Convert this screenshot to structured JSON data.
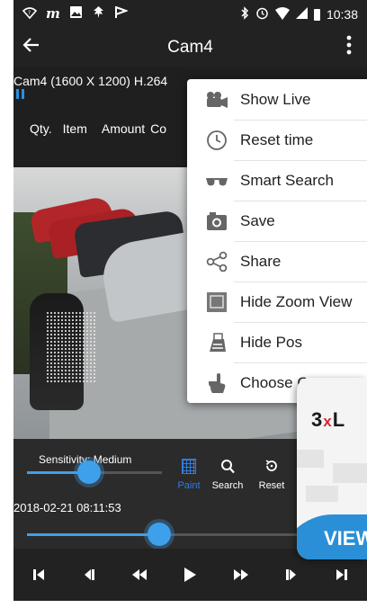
{
  "status_bar": {
    "left_icons": [
      "wifi-icon",
      "m-app-icon",
      "image-icon",
      "leaf-icon",
      "flag-icon"
    ],
    "right_icons": [
      "bluetooth-icon",
      "alarm-icon",
      "wifi-signal-icon",
      "cell-signal-icon",
      "battery-icon"
    ],
    "time": "10:38"
  },
  "app_bar": {
    "title": "Cam4",
    "back_icon": "arrow-left-icon",
    "overflow_icon": "more-vert-icon"
  },
  "camera": {
    "info": "Cam4 (1600 X 1200)  H.264",
    "state_icon": "pause-icon"
  },
  "pos_header": {
    "columns": [
      "Qty.",
      "Item",
      "Amount",
      "Co"
    ]
  },
  "menu": {
    "items": [
      {
        "label": "Show Live",
        "icon": "video-camera-icon"
      },
      {
        "label": "Reset time",
        "icon": "clock-icon"
      },
      {
        "label": "Smart Search",
        "icon": "glasses-icon"
      },
      {
        "label": "Save",
        "icon": "camera-icon"
      },
      {
        "label": "Share",
        "icon": "share-icon"
      },
      {
        "label": "Hide Zoom View",
        "icon": "zoom-view-icon"
      },
      {
        "label": "Hide Pos",
        "icon": "pos-terminal-icon"
      },
      {
        "label": "Choose Came",
        "icon": "hand-pointer-icon"
      }
    ]
  },
  "controls": {
    "sensitivity_label": "Sensitivity:",
    "sensitivity_value": "Medium",
    "sensitivity_level": 0.46,
    "tools": [
      {
        "label": "Paint",
        "icon": "paint-grid-icon",
        "active": true
      },
      {
        "label": "Search",
        "icon": "search-icon",
        "active": false
      },
      {
        "label": "Reset",
        "icon": "reset-icon",
        "active": false
      }
    ],
    "timestamp": "2018-02-21 08:11:53",
    "timeline_position": 0.39,
    "accent_color": "#3ea0ea",
    "active_tool_color": "#2f7de0"
  },
  "transport": {
    "buttons": [
      "skip-start-icon",
      "step-back-icon",
      "rewind-icon",
      "play-icon",
      "fast-forward-icon",
      "step-forward-icon",
      "skip-end-icon"
    ]
  },
  "promo": {
    "brand_prefix": "3",
    "brand_x": "x",
    "brand_suffix": "L",
    "banner": "VIEW"
  }
}
